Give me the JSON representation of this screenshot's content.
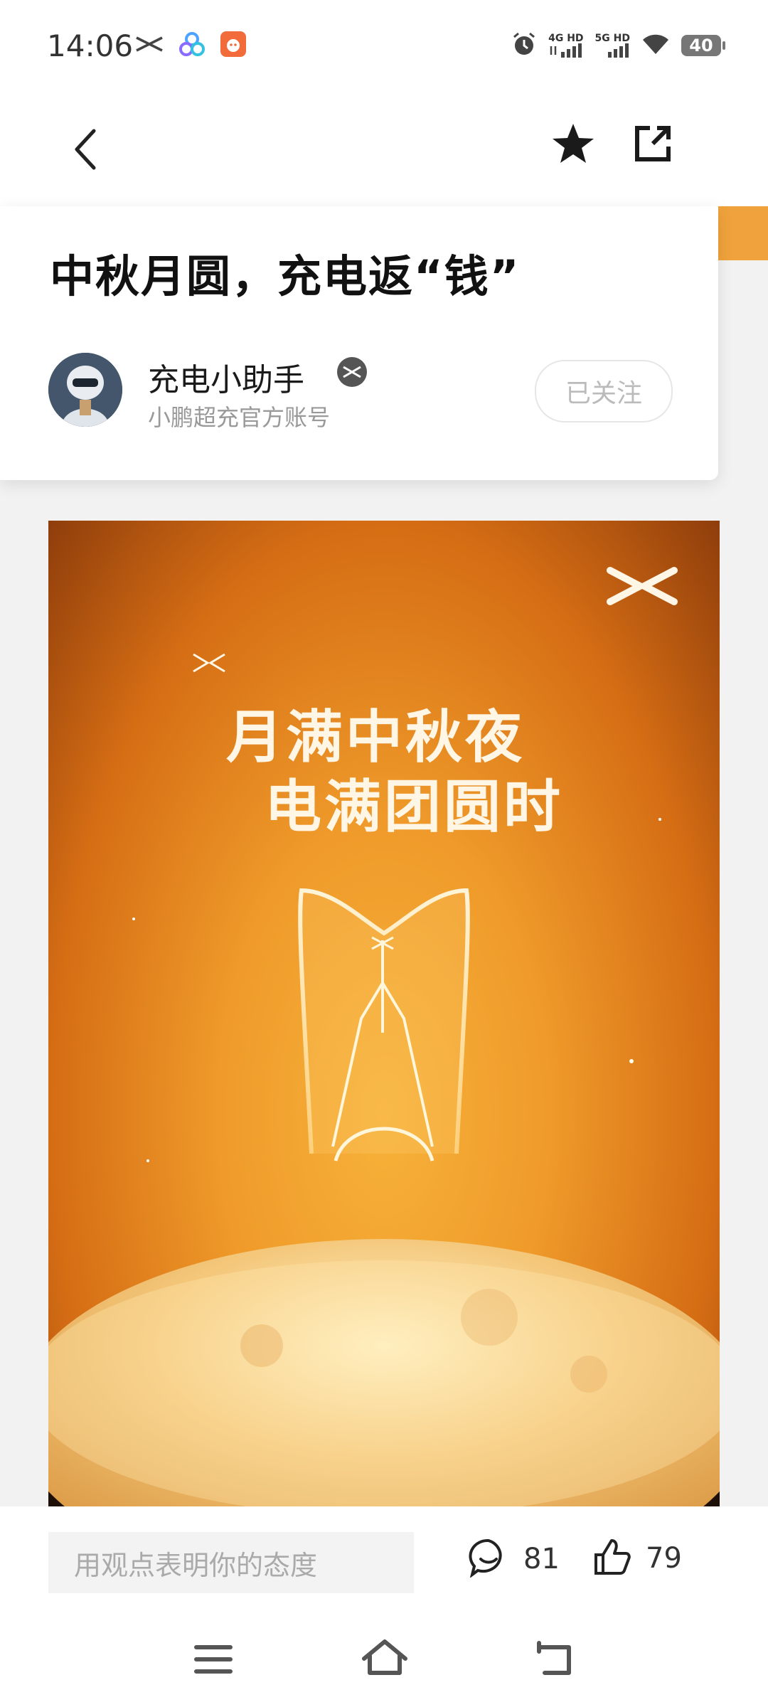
{
  "status_bar": {
    "time": "14:06",
    "signal1_label": "4G HD",
    "signal2_label": "5G HD",
    "battery": "40",
    "icons": [
      "xpeng-logo-icon",
      "cluster-app-icon",
      "orange-app-icon",
      "alarm-icon",
      "signal-icon",
      "wifi-icon",
      "battery-icon"
    ]
  },
  "nav": {
    "icons": [
      "back-icon",
      "star-icon",
      "share-icon"
    ]
  },
  "article": {
    "title": "中秋月圆，充电返“钱”",
    "author_name": "充电小助手",
    "author_desc": "小鹏超充官方账号",
    "follow_label": "已关注"
  },
  "poster": {
    "line1": "月满中秋夜",
    "line2": "电满团圆时"
  },
  "comment_bar": {
    "placeholder": "用观点表明你的态度",
    "comment_count": "81",
    "like_count": "79"
  },
  "system_nav": {
    "icons": [
      "menu-icon",
      "home-icon",
      "back-nav-icon"
    ]
  },
  "colors": {
    "accent": "#f0a33c",
    "poster_orange": "#ef9a2a"
  }
}
